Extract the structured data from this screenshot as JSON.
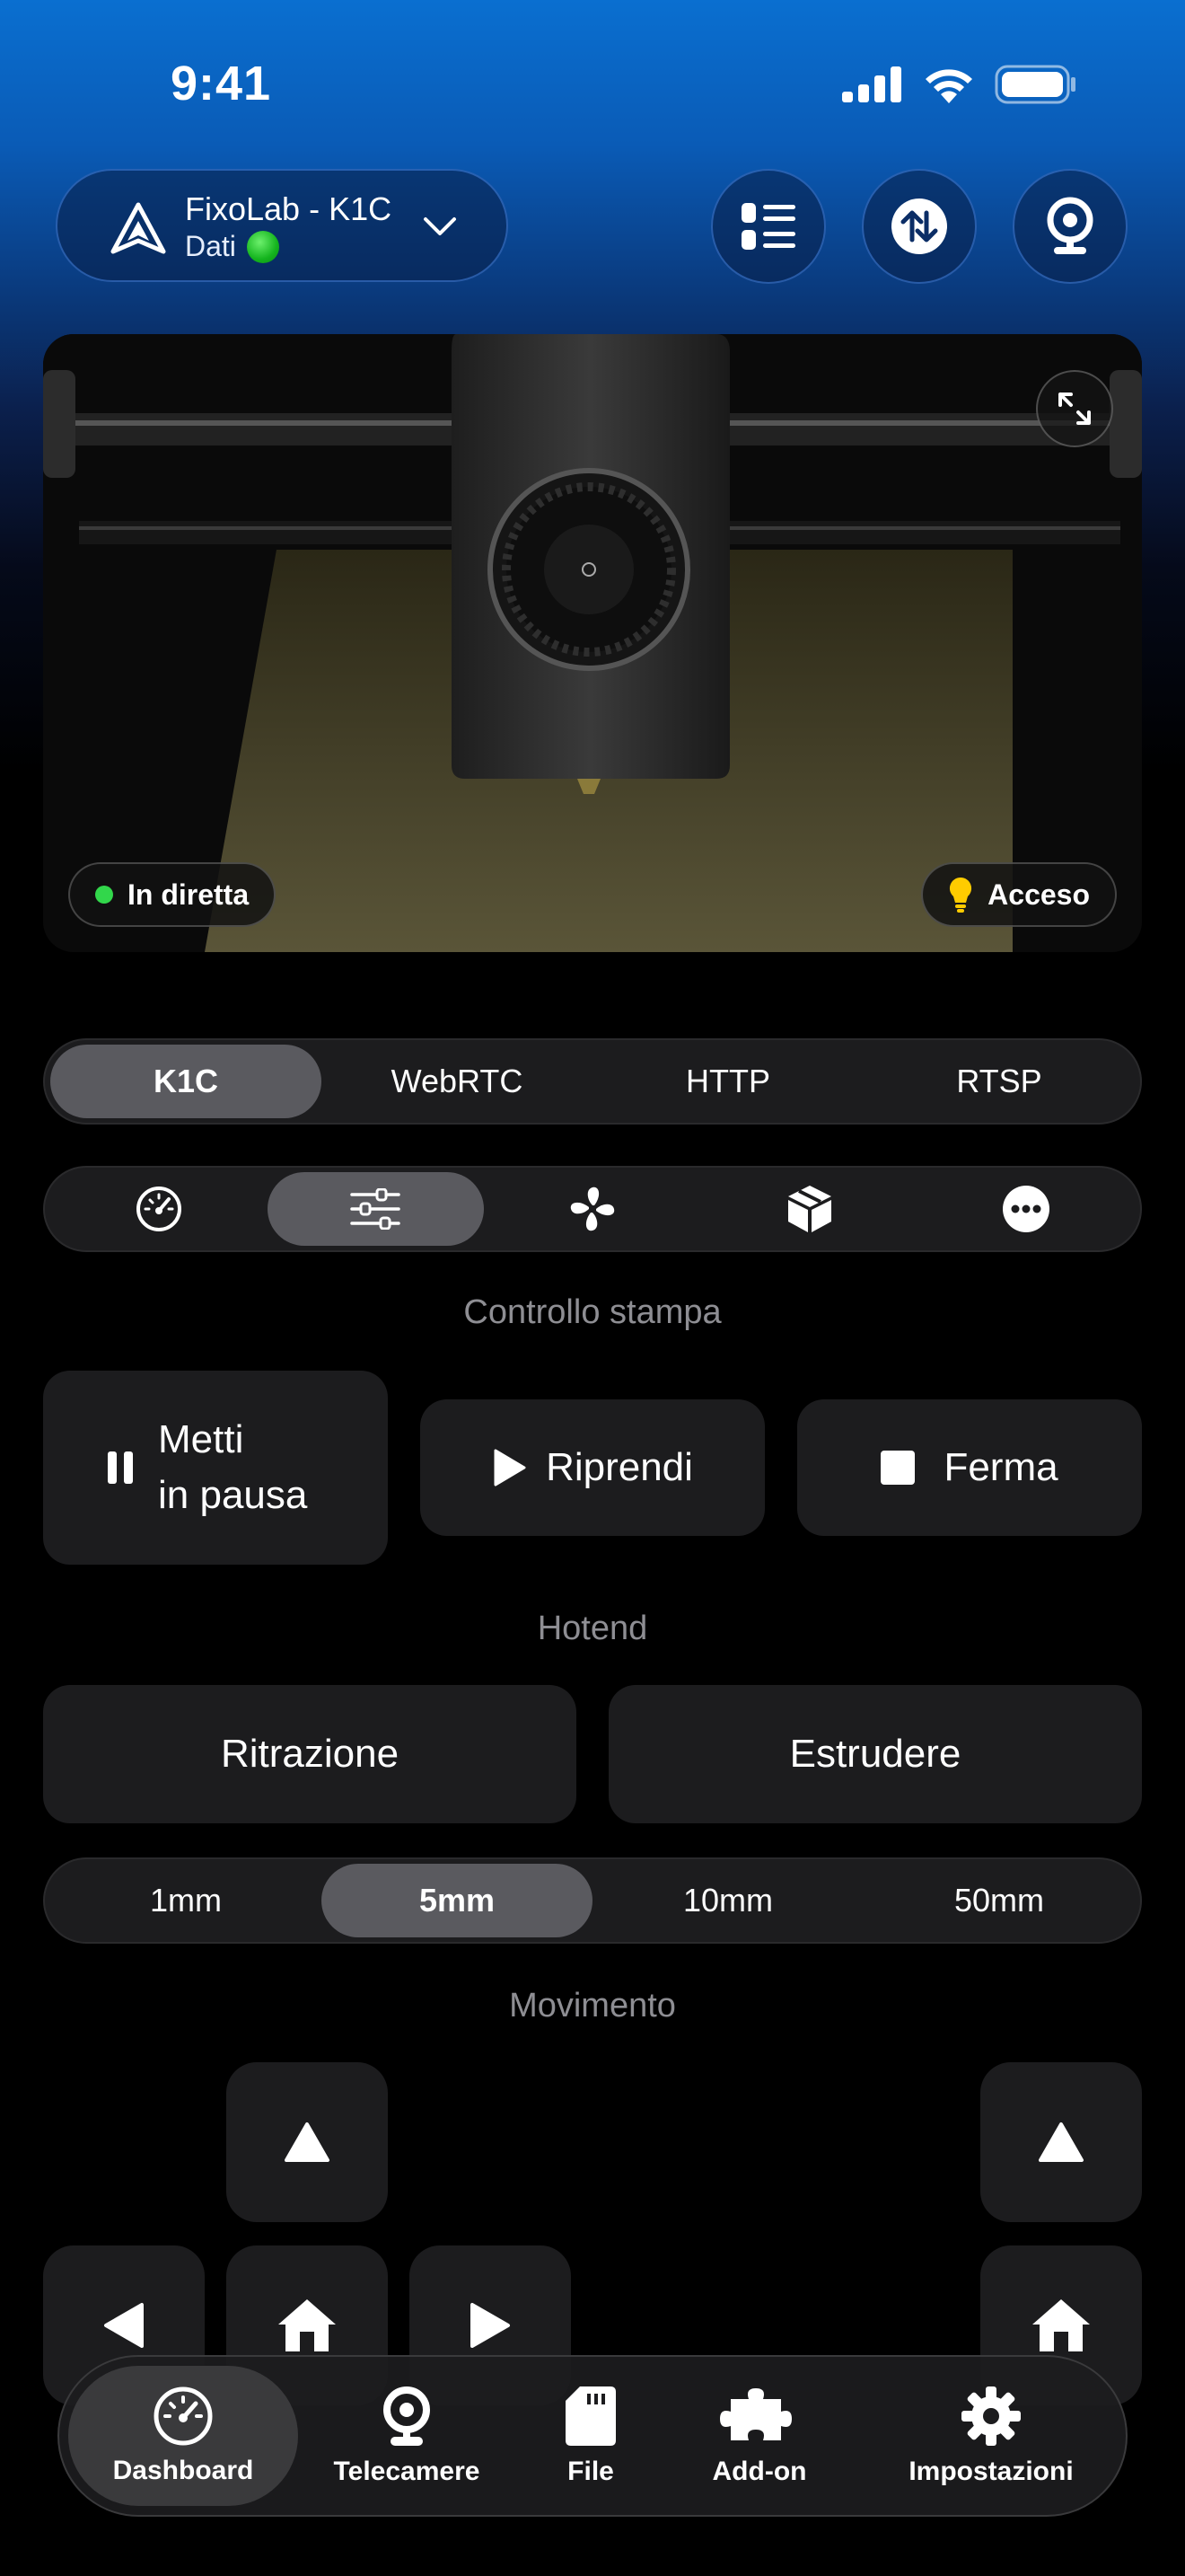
{
  "status": {
    "time": "9:41"
  },
  "header": {
    "printer_name": "FixoLab - K1C",
    "printer_sub": "Dati"
  },
  "camera": {
    "live_label": "In diretta",
    "light_label": "Acceso"
  },
  "stream_tabs": [
    "K1C",
    "WebRTC",
    "HTTP",
    "RTSP"
  ],
  "stream_active": "K1C",
  "icon_tabs": [
    "gauge-icon",
    "sliders-icon",
    "fan-icon",
    "cube-icon",
    "more-icon"
  ],
  "sections": {
    "print_control": "Controllo stampa",
    "hotend": "Hotend",
    "movement": "Movimento"
  },
  "print_buttons": {
    "pause_line1": "Metti",
    "pause_line2": "in pausa",
    "resume": "Riprendi",
    "stop": "Ferma"
  },
  "hotend_buttons": {
    "retract": "Ritrazione",
    "extrude": "Estrudere"
  },
  "distances": [
    "1mm",
    "5mm",
    "10mm",
    "50mm"
  ],
  "distance_active": "5mm",
  "tabbar": {
    "dashboard": "Dashboard",
    "cameras": "Telecamere",
    "files": "File",
    "addons": "Add-on",
    "settings": "Impostazioni"
  },
  "colors": {
    "accent": "#0a6fd0",
    "live": "#32d74b",
    "bulb": "#ffcc00",
    "panel": "#1c1c1e"
  }
}
